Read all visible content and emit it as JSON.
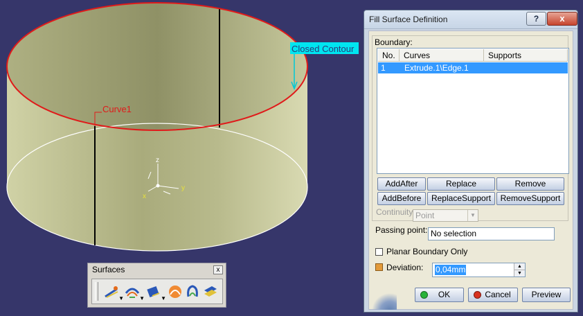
{
  "viewport": {
    "annotation_closed_contour": "Closed Contour",
    "annotation_curve": "Curve1",
    "axis_z": "z",
    "axis_x": "x",
    "axis_y": "y",
    "colors": {
      "background": "#36366a",
      "surface": "#c8c99a",
      "highlight": "#e01a1a",
      "tag_bg": "#00e5f0"
    }
  },
  "toolbar": {
    "title": "Surfaces",
    "close": "x",
    "icons": [
      "fill-surface-icon",
      "multi-sections-icon",
      "blend-icon",
      "offset-icon",
      "sweep-icon",
      "extrude-icon"
    ]
  },
  "dialog": {
    "title": "Fill Surface Definition",
    "help": "?",
    "close": "x",
    "boundary_label": "Boundary:",
    "table": {
      "headers": [
        "No.",
        "Curves",
        "Supports"
      ],
      "rows": [
        {
          "no": "1",
          "curve": "Extrude.1\\Edge.1",
          "support": ""
        }
      ]
    },
    "buttons": {
      "add_after": "AddAfter",
      "replace": "Replace",
      "remove": "Remove",
      "add_before": "AddBefore",
      "replace_support": "ReplaceSupport",
      "remove_support": "RemoveSupport",
      "ok": "OK",
      "cancel": "Cancel",
      "preview": "Preview"
    },
    "continuity_label": "Continuity:",
    "continuity_value": "Point",
    "passing_point_label": "Passing point:",
    "passing_point_value": "No selection",
    "planar_label": "Planar Boundary Only",
    "deviation_label": "Deviation:",
    "deviation_value": "0,04mm"
  }
}
